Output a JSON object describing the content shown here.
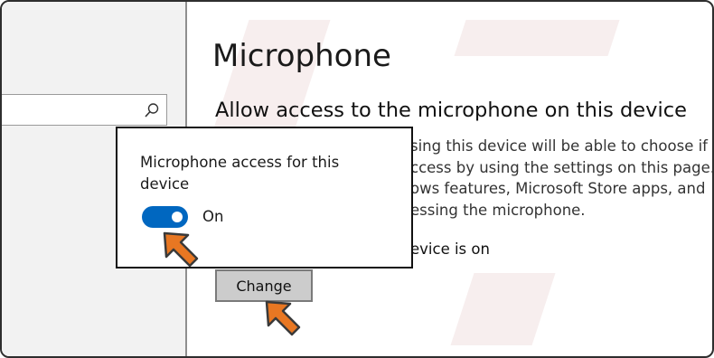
{
  "colors": {
    "accent": "#0067c0",
    "arrow": "#e87722",
    "button_bg": "#cccccc",
    "popup_border": "#111111"
  },
  "search": {
    "icon": "search-icon"
  },
  "main": {
    "title": "Microphone",
    "section_heading": "Allow access to the microphone on this device",
    "description_lines": [
      "sing this device will be able to choose if",
      "ccess by using the settings on this page.",
      "ows features, Microsoft Store apps, and",
      "essing the microphone."
    ],
    "status_text": "evice is on",
    "change_button_label": "Change"
  },
  "popup": {
    "title": "Microphone access for this device",
    "toggle_state_label": "On",
    "toggle_on": true
  }
}
